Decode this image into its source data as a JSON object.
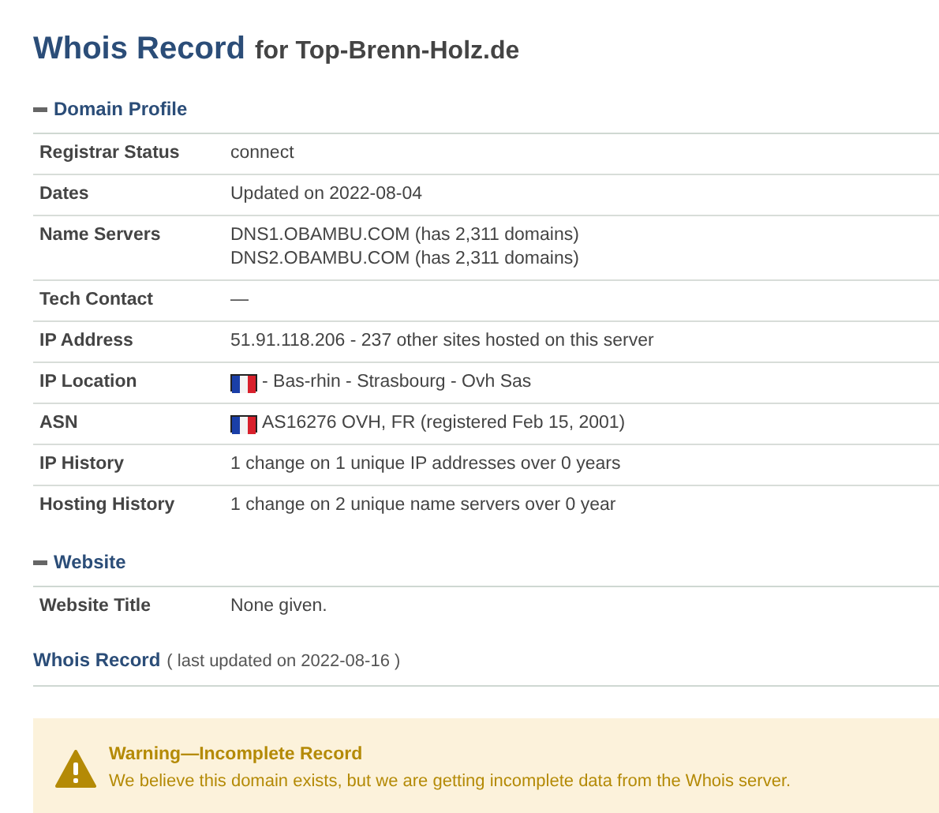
{
  "title": {
    "main": "Whois Record",
    "suffix": "for Top-Brenn-Holz.de"
  },
  "sections": [
    {
      "heading": "Domain Profile",
      "expanded": true,
      "rows": [
        {
          "label": "Registrar Status",
          "lines": [
            "connect"
          ],
          "flag": false
        },
        {
          "label": "Dates",
          "lines": [
            "Updated on 2022-08-04"
          ],
          "flag": false
        },
        {
          "label": "Name Servers",
          "lines": [
            "DNS1.OBAMBU.COM (has 2,311 domains)",
            "DNS2.OBAMBU.COM (has 2,311 domains)"
          ],
          "flag": false
        },
        {
          "label": "Tech Contact",
          "lines": [
            "—"
          ],
          "flag": false
        },
        {
          "label": "IP Address",
          "lines": [
            "51.91.118.206 - 237 other sites hosted on this server"
          ],
          "flag": false
        },
        {
          "label": "IP Location",
          "lines": [
            "- Bas-rhin - Strasbourg - Ovh Sas"
          ],
          "flag": true
        },
        {
          "label": "ASN",
          "lines": [
            "AS16276 OVH, FR (registered Feb 15, 2001)"
          ],
          "flag": true
        },
        {
          "label": "IP History",
          "lines": [
            "1 change on 1 unique IP addresses over 0 years"
          ],
          "flag": false
        },
        {
          "label": "Hosting History",
          "lines": [
            "1 change on 2 unique name servers over 0 year"
          ],
          "flag": false
        }
      ]
    },
    {
      "heading": "Website",
      "expanded": true,
      "rows": [
        {
          "label": "Website Title",
          "lines": [
            "None given."
          ],
          "flag": false
        }
      ]
    }
  ],
  "record": {
    "heading": "Whois Record",
    "note": "( last updated on 2022-08-16 )"
  },
  "warning": {
    "title": "Warning—Incomplete Record",
    "message": "We believe this domain exists, but we are getting incomplete data from the Whois server."
  }
}
